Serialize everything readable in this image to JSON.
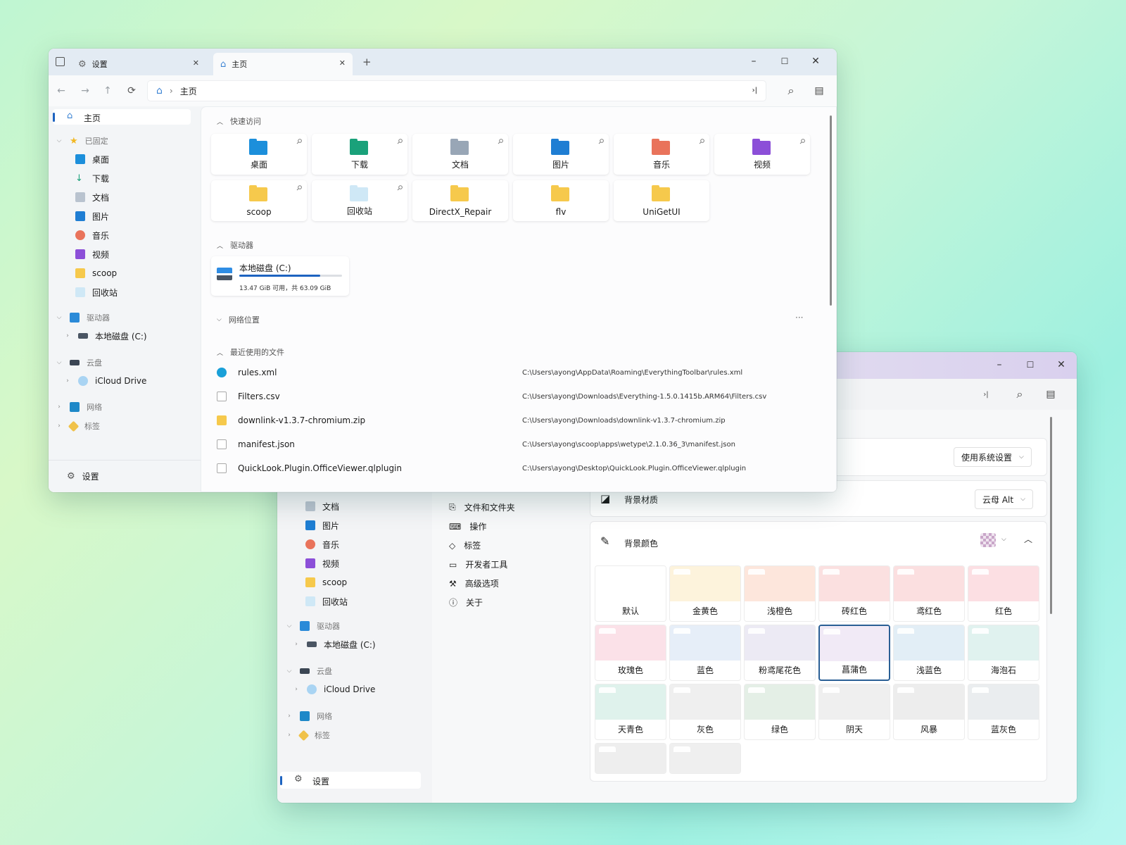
{
  "front": {
    "tabs": [
      {
        "label": "设置"
      },
      {
        "label": "主页"
      }
    ],
    "new_tab": "+",
    "caption": {
      "min": "–",
      "max": "☐",
      "close": "✕"
    },
    "nav": {
      "back": "←",
      "forward": "→",
      "up": "↑",
      "refresh": "⟳"
    },
    "address": {
      "home": "⌂",
      "sep": "›",
      "label": "主页"
    },
    "toolbar_icons": {
      "pane": "›|",
      "search": "⌕",
      "preview": "▤"
    },
    "sidebar": {
      "home": "主页",
      "pinned_group": "已固定",
      "pinned": [
        "桌面",
        "下载",
        "文档",
        "图片",
        "音乐",
        "视频",
        "scoop",
        "回收站"
      ],
      "drives_group": "驱动器",
      "drives": [
        "本地磁盘 (C:)"
      ],
      "cloud_group": "云盘",
      "cloud": [
        "iCloud Drive"
      ],
      "network_group": "网络",
      "tags_group": "标签",
      "settings": "设置"
    },
    "quick_access": {
      "header": "快速访问",
      "items": [
        "桌面",
        "下载",
        "文档",
        "图片",
        "音乐",
        "视频",
        "scoop",
        "回收站",
        "DirectX_Repair",
        "flv",
        "UniGetUI"
      ]
    },
    "drives_section": {
      "header": "驱动器",
      "drive": {
        "name": "本地磁盘 (C:)",
        "detail": "13.47 GiB 可用，共 63.09 GiB",
        "used_fraction": 0.79
      }
    },
    "network_section": {
      "header": "网络位置",
      "more": "···"
    },
    "recent": {
      "header": "最近使用的文件",
      "files": [
        {
          "name": "rules.xml",
          "path": "C:\\Users\\ayong\\AppData\\Roaming\\EverythingToolbar\\rules.xml"
        },
        {
          "name": "Filters.csv",
          "path": "C:\\Users\\ayong\\Downloads\\Everything-1.5.0.1415b.ARM64\\Filters.csv"
        },
        {
          "name": "downlink-v1.3.7-chromium.zip",
          "path": "C:\\Users\\ayong\\Downloads\\downlink-v1.3.7-chromium.zip"
        },
        {
          "name": "manifest.json",
          "path": "C:\\Users\\ayong\\scoop\\apps\\wetype\\2.1.0.36_3\\manifest.json"
        },
        {
          "name": "QuickLook.Plugin.OfficeViewer.qlplugin",
          "path": "C:\\Users\\ayong\\Desktop\\QuickLook.Plugin.OfficeViewer.qlplugin"
        }
      ]
    }
  },
  "back": {
    "sidebar": {
      "items": [
        "文档",
        "图片",
        "音乐",
        "视频",
        "scoop",
        "回收站"
      ],
      "drives_group": "驱动器",
      "drives": [
        "本地磁盘 (C:)"
      ],
      "cloud_group": "云盘",
      "cloud": [
        "iCloud Drive"
      ],
      "network_group": "网络",
      "tags_group": "标签",
      "settings": "设置"
    },
    "settings_nav": [
      "文件和文件夹",
      "操作",
      "标签",
      "开发者工具",
      "高级选项",
      "关于"
    ],
    "theme_dropdown": "使用系统设置",
    "material": {
      "label": "背景材质",
      "value": "云母 Alt"
    },
    "color": {
      "label": "背景颜色"
    },
    "swatches": [
      {
        "label": "默认",
        "color": "#ffffff"
      },
      {
        "label": "金黄色",
        "color": "#fdf3dc"
      },
      {
        "label": "浅橙色",
        "color": "#fde6dc"
      },
      {
        "label": "砖红色",
        "color": "#fbe0e0"
      },
      {
        "label": "鸢红色",
        "color": "#fbdfe0"
      },
      {
        "label": "红色",
        "color": "#fcdfe3"
      },
      {
        "label": "玫瑰色",
        "color": "#fbe1e8"
      },
      {
        "label": "蓝色",
        "color": "#e6eef8"
      },
      {
        "label": "粉鸢尾花色",
        "color": "#eceaf4"
      },
      {
        "label": "菖蒲色",
        "color": "#f1eaf6"
      },
      {
        "label": "浅蓝色",
        "color": "#e2eef6"
      },
      {
        "label": "海泡石",
        "color": "#e0f2ef"
      },
      {
        "label": "天青色",
        "color": "#dff2ec"
      },
      {
        "label": "灰色",
        "color": "#efefef"
      },
      {
        "label": "绿色",
        "color": "#e4efe6"
      },
      {
        "label": "阴天",
        "color": "#efefef"
      },
      {
        "label": "风暴",
        "color": "#ededed"
      },
      {
        "label": "蓝灰色",
        "color": "#eaedef"
      },
      {
        "label": "",
        "color": "#eeeeee"
      },
      {
        "label": "",
        "color": "#efefef"
      }
    ]
  }
}
